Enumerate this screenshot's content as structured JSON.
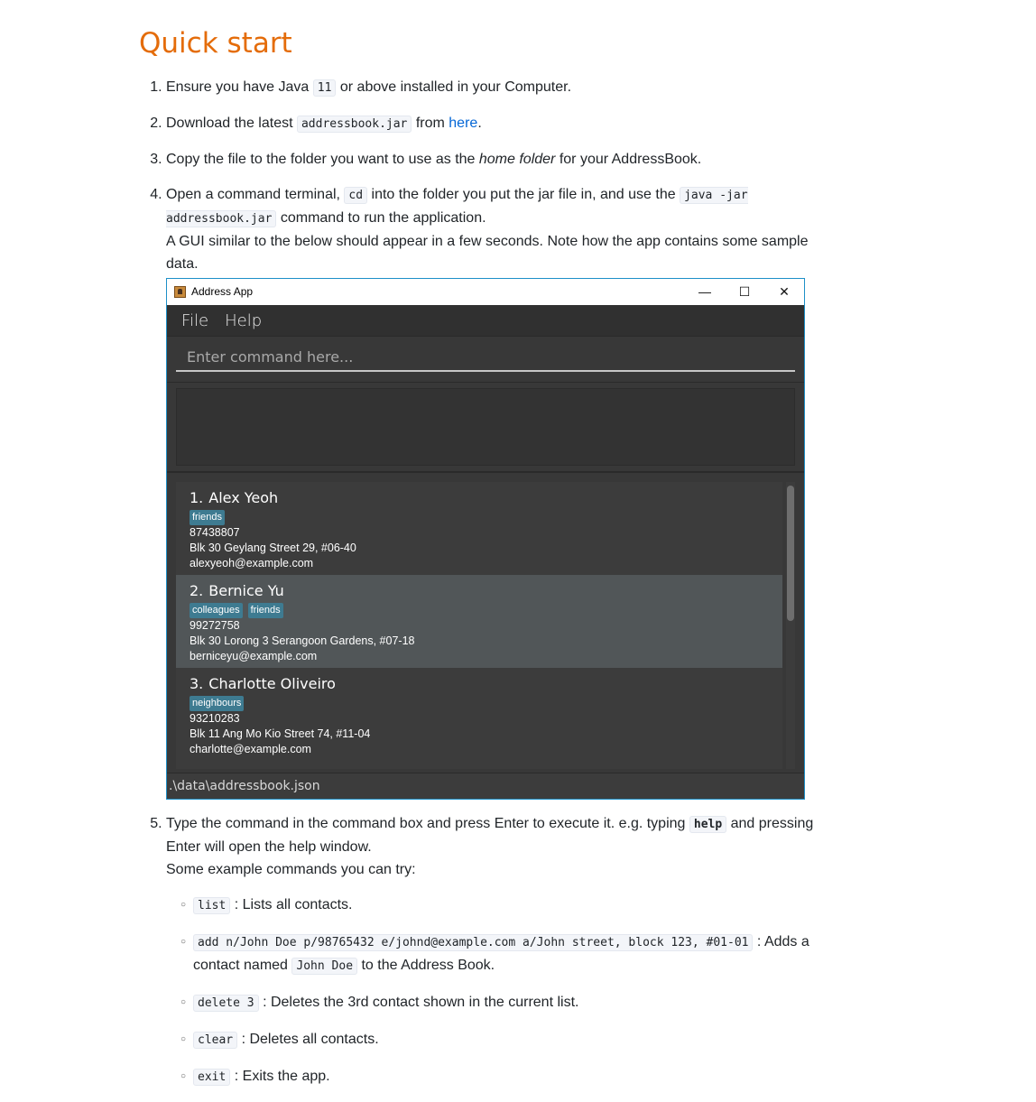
{
  "heading": "Quick start",
  "steps": {
    "s1": {
      "a": "Ensure you have Java ",
      "code": "11",
      "b": " or above installed in your Computer."
    },
    "s2": {
      "a": "Download the latest ",
      "code": "addressbook.jar",
      "b": " from ",
      "link": "here",
      "c": "."
    },
    "s3": {
      "a": "Copy the file to the folder you want to use as the ",
      "em": "home folder",
      "b": " for your AddressBook."
    },
    "s4": {
      "a": "Open a command terminal, ",
      "code1": "cd",
      "b": " into the folder you put the jar file in, and use the ",
      "code2": "java -jar addressbook.jar",
      "c": " command to run the application.",
      "d": "A GUI similar to the below should appear in a few seconds. Note how the app contains some sample data."
    },
    "s5": {
      "a": "Type the command in the command box and press Enter to execute it. e.g. typing ",
      "code": "help",
      "b": " and pressing Enter will open the help window.",
      "c": "Some example commands you can try:"
    }
  },
  "examples": [
    {
      "code": "list",
      "desc": " : Lists all contacts."
    },
    {
      "code": "add n/John Doe p/98765432 e/johnd@example.com a/John street, block 123, #01-01",
      "desc": " : Adds a contact named ",
      "code2": "John Doe",
      "desc2": " to the Address Book."
    },
    {
      "code": "delete 3",
      "desc": " : Deletes the 3rd contact shown in the current list."
    },
    {
      "code": "clear",
      "desc": " : Deletes all contacts."
    },
    {
      "code": "exit",
      "desc": " : Exits the app."
    }
  ],
  "app": {
    "title": "Address App",
    "controls": {
      "minimize": "—",
      "maximize": "☐",
      "close": "✕"
    },
    "menu": [
      "File",
      "Help"
    ],
    "command_placeholder": "Enter command here...",
    "persons": [
      {
        "index": "1.",
        "name": "Alex Yeoh",
        "tags": [
          "friends"
        ],
        "phone": "87438807",
        "address": "Blk 30 Geylang Street 29, #06-40",
        "email": "alexyeoh@example.com"
      },
      {
        "index": "2.",
        "name": "Bernice Yu",
        "tags": [
          "colleagues",
          "friends"
        ],
        "phone": "99272758",
        "address": "Blk 30 Lorong 3 Serangoon Gardens, #07-18",
        "email": "berniceyu@example.com"
      },
      {
        "index": "3.",
        "name": "Charlotte Oliveiro",
        "tags": [
          "neighbours"
        ],
        "phone": "93210283",
        "address": "Blk 11 Ang Mo Kio Street 74, #11-04",
        "email": "charlotte@example.com"
      }
    ],
    "status": ".\\data\\addressbook.json"
  }
}
